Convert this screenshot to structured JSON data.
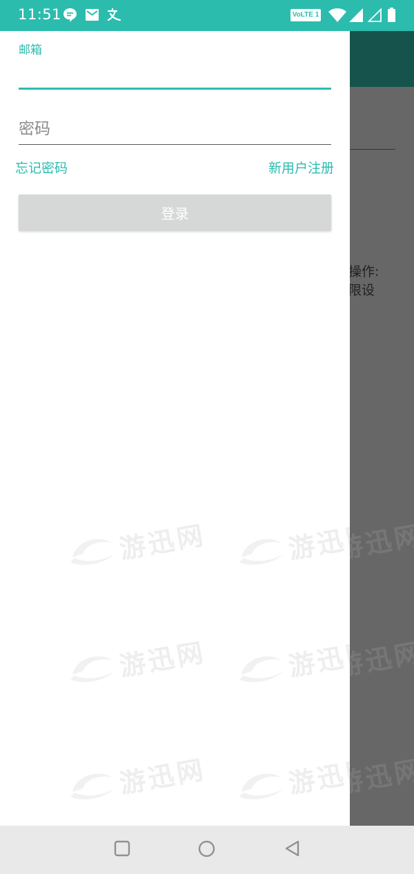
{
  "status_bar": {
    "time": "11:51",
    "volte_badge": "VoLTE 1",
    "icons": [
      "message-bubble-icon",
      "mail-icon",
      "translate-icon",
      "wifi-icon",
      "signal-icon",
      "signal-empty-icon",
      "battery-icon"
    ]
  },
  "background_app": {
    "visible_text_line1": "操作:",
    "visible_text_line2": "限设",
    "toolbar_color": "#15534c"
  },
  "login_form": {
    "email_label": "邮箱",
    "email_value": "",
    "password_placeholder": "密码",
    "forgot_password": "忘记密码",
    "register": "新用户注册",
    "login_button": "登录"
  },
  "watermark": {
    "text": "游迅网"
  },
  "navigation_bar": {
    "buttons": [
      "recent-apps",
      "home",
      "back"
    ]
  },
  "colors": {
    "accent": "#2bbcae",
    "button_disabled": "#d6d7d7",
    "scrim": "#676767"
  }
}
